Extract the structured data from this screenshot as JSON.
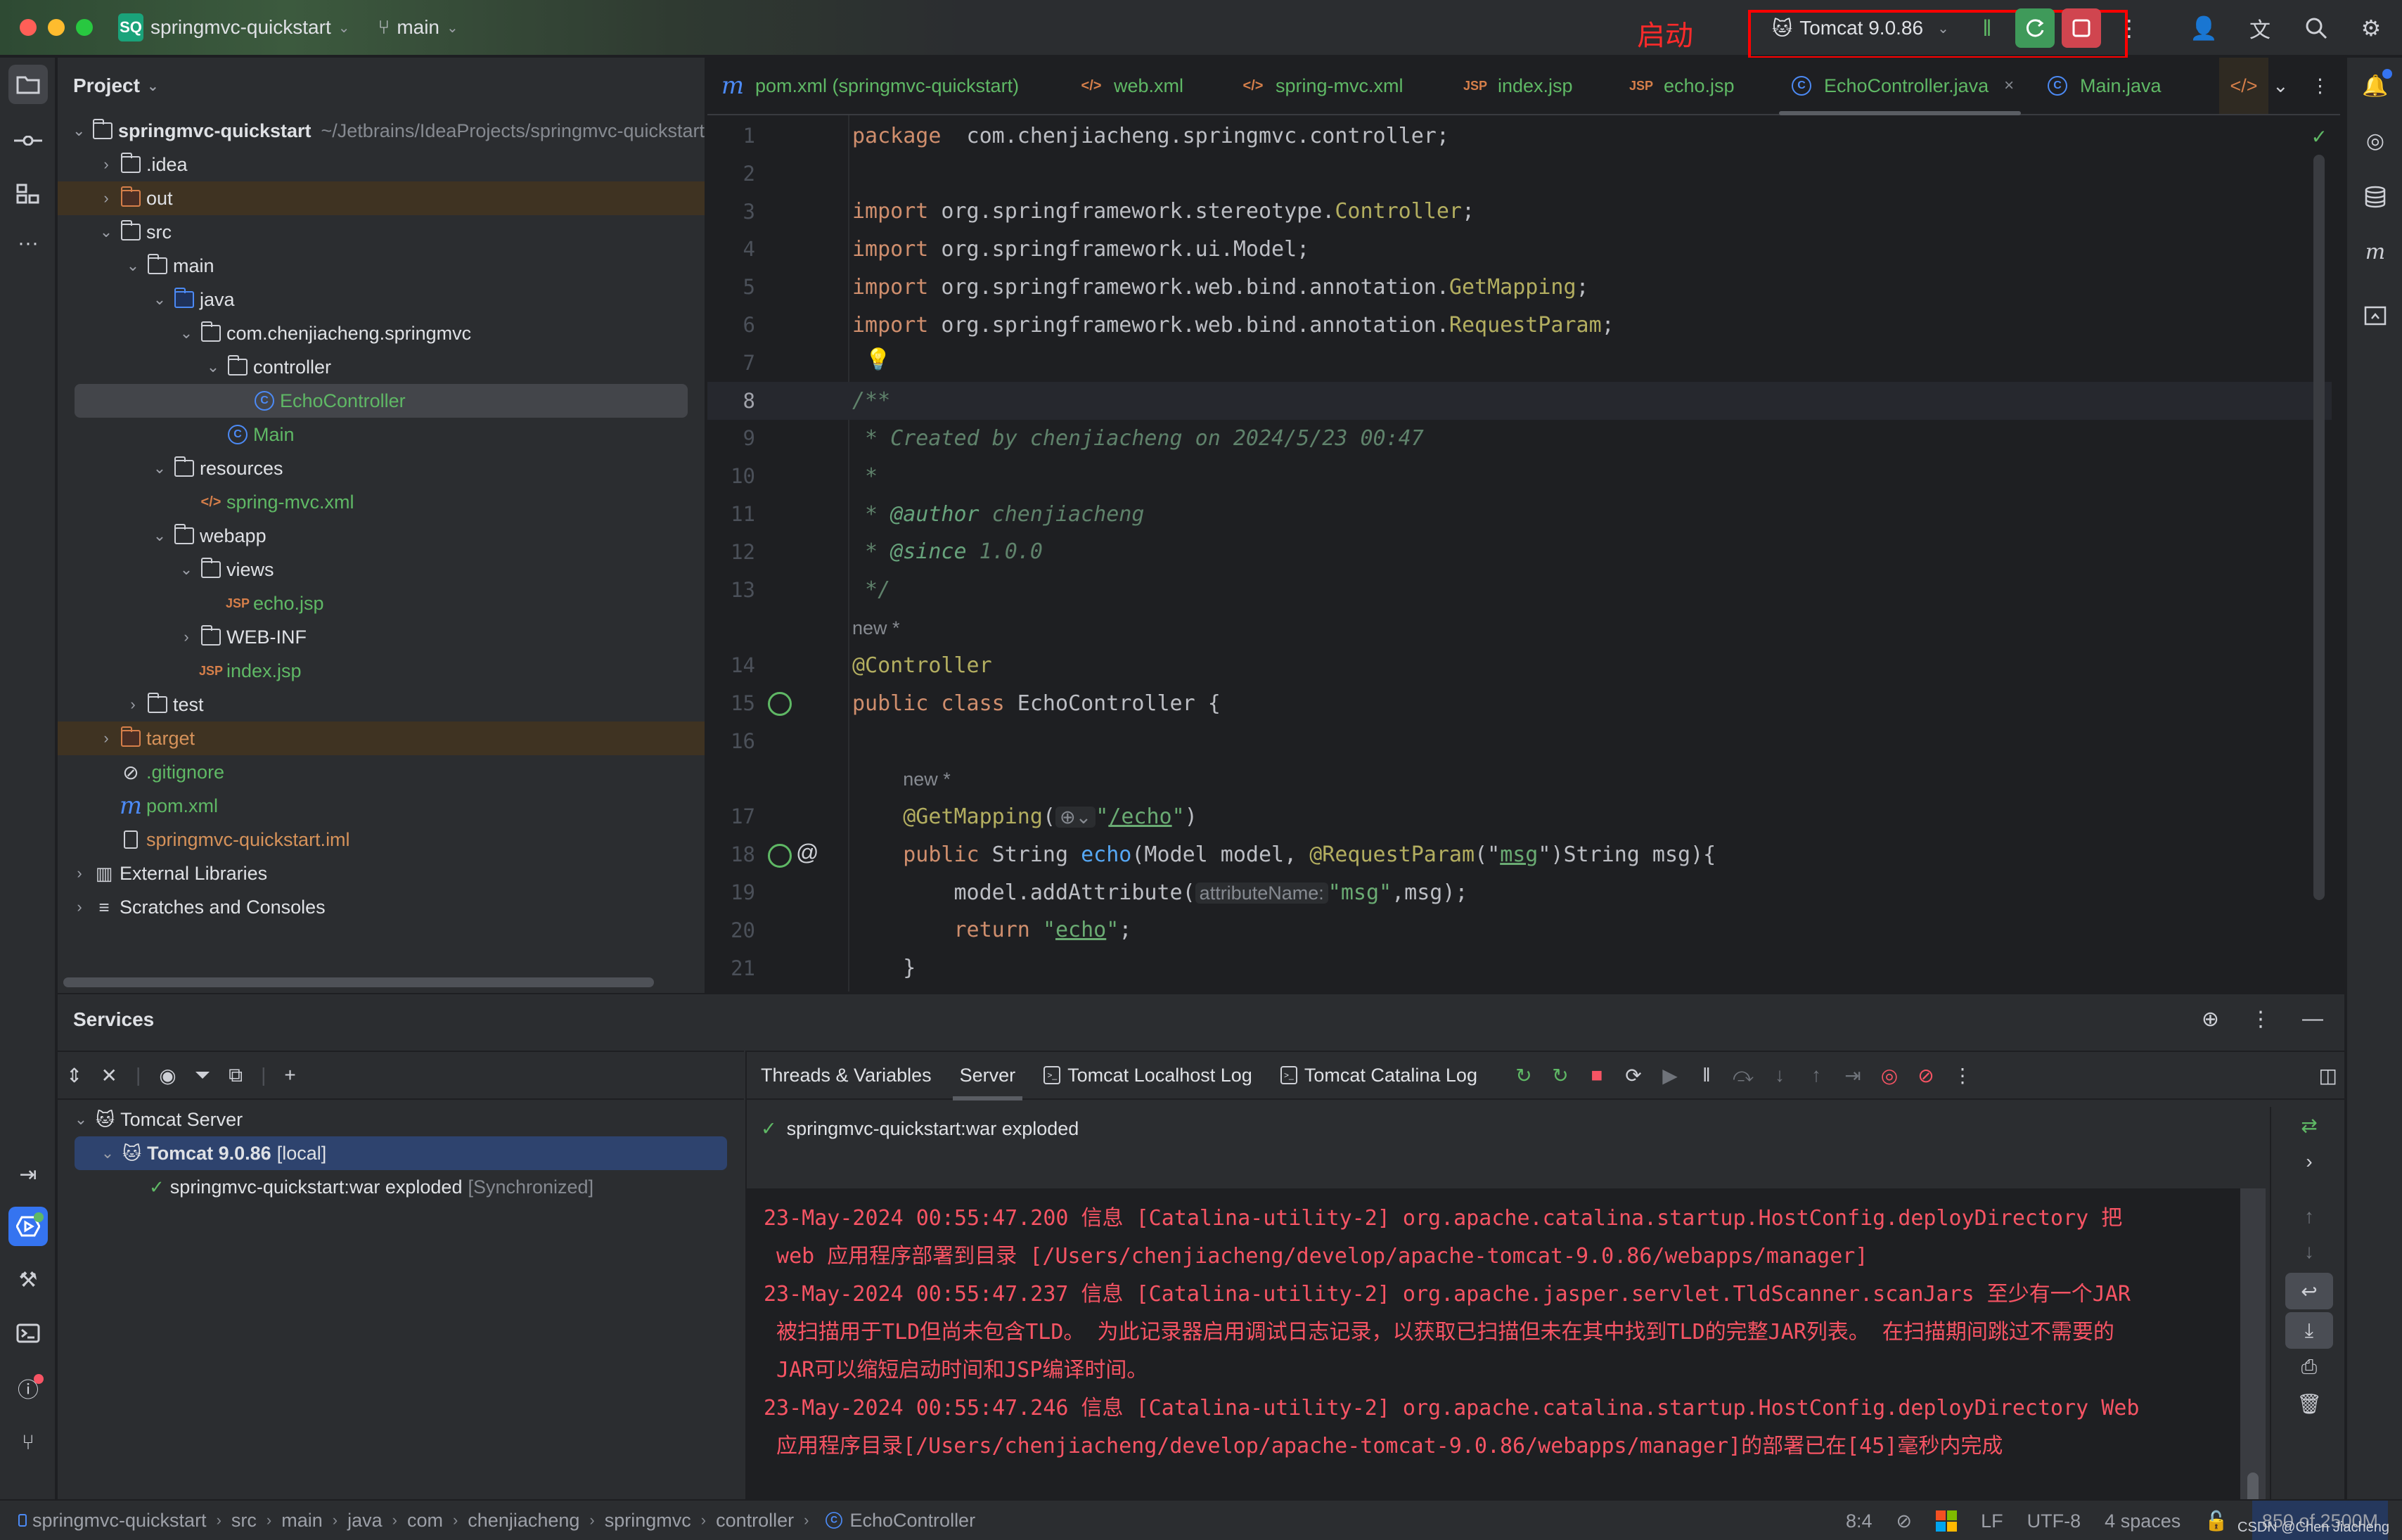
{
  "titlebar": {
    "project_badge": "SQ",
    "project_name": "springmvc-quickstart",
    "branch": "main",
    "annotation_label": "启动",
    "run_config": "Tomcat 9.0.86"
  },
  "left_strip": {
    "items": [
      "project",
      "commit",
      "structure",
      "more",
      "run-services",
      "services",
      "build",
      "terminal",
      "problems",
      "git"
    ]
  },
  "project_panel": {
    "title": "Project",
    "tree": [
      {
        "label": "springmvc-quickstart",
        "extra": "~/Jetbrains/IdeaProjects/springmvc-quickstart",
        "depth": 0,
        "arrow": "v",
        "icon": "module-folder",
        "style": "bold"
      },
      {
        "label": ".idea",
        "depth": 1,
        "arrow": ">",
        "icon": "folder"
      },
      {
        "label": "out",
        "depth": 1,
        "arrow": ">",
        "icon": "folder-orange",
        "style": "excluded"
      },
      {
        "label": "src",
        "depth": 1,
        "arrow": "v",
        "icon": "folder"
      },
      {
        "label": "main",
        "depth": 2,
        "arrow": "v",
        "icon": "folder"
      },
      {
        "label": "java",
        "depth": 3,
        "arrow": "v",
        "icon": "folder-blue"
      },
      {
        "label": "com.chenjiacheng.springmvc",
        "depth": 4,
        "arrow": "v",
        "icon": "package"
      },
      {
        "label": "controller",
        "depth": 5,
        "arrow": "v",
        "icon": "package"
      },
      {
        "label": "EchoController",
        "depth": 6,
        "arrow": "",
        "icon": "class",
        "style": "green selected"
      },
      {
        "label": "Main",
        "depth": 5,
        "arrow": "",
        "icon": "class",
        "style": "green"
      },
      {
        "label": "resources",
        "depth": 3,
        "arrow": "v",
        "icon": "resources"
      },
      {
        "label": "spring-mvc.xml",
        "depth": 4,
        "arrow": "",
        "icon": "xml",
        "style": "green"
      },
      {
        "label": "webapp",
        "depth": 3,
        "arrow": "v",
        "icon": "web-folder"
      },
      {
        "label": "views",
        "depth": 4,
        "arrow": "v",
        "icon": "folder"
      },
      {
        "label": "echo.jsp",
        "depth": 5,
        "arrow": "",
        "icon": "jsp",
        "style": "green"
      },
      {
        "label": "WEB-INF",
        "depth": 4,
        "arrow": ">",
        "icon": "folder"
      },
      {
        "label": "index.jsp",
        "depth": 4,
        "arrow": "",
        "icon": "jsp",
        "style": "green"
      },
      {
        "label": "test",
        "depth": 2,
        "arrow": ">",
        "icon": "folder"
      },
      {
        "label": "target",
        "depth": 1,
        "arrow": ">",
        "icon": "folder-orange",
        "style": "excluded orange"
      },
      {
        "label": ".gitignore",
        "depth": 1,
        "arrow": "",
        "icon": "ignore",
        "style": "green"
      },
      {
        "label": "pom.xml",
        "depth": 1,
        "arrow": "",
        "icon": "maven",
        "style": "green"
      },
      {
        "label": "springmvc-quickstart.iml",
        "depth": 1,
        "arrow": "",
        "icon": "iml",
        "style": "orange"
      },
      {
        "label": "External Libraries",
        "depth": 0,
        "arrow": ">",
        "icon": "libraries"
      },
      {
        "label": "Scratches and Consoles",
        "depth": 0,
        "arrow": ">",
        "icon": "scratches"
      }
    ]
  },
  "editor_tabs": [
    {
      "label": "pom.xml (springmvc-quickstart)",
      "icon": "maven"
    },
    {
      "label": "web.xml",
      "icon": "xml-web"
    },
    {
      "label": "spring-mvc.xml",
      "icon": "xml-spring"
    },
    {
      "label": "index.jsp",
      "icon": "jsp"
    },
    {
      "label": "echo.jsp",
      "icon": "jsp"
    },
    {
      "label": "EchoController.java",
      "icon": "class",
      "active": true
    },
    {
      "label": "Main.java",
      "icon": "class"
    }
  ],
  "editor": {
    "current_line": 8,
    "inlay_new": "new *",
    "hint_attribute_name": "attributeName:",
    "lines": [
      {
        "n": "1",
        "segs": [
          [
            "kw",
            "package"
          ],
          [
            "",
            "  com.chenjiacheng.springmvc.controller;"
          ]
        ]
      },
      {
        "n": "2",
        "segs": []
      },
      {
        "n": "3",
        "segs": [
          [
            "kw",
            "import"
          ],
          [
            "",
            " org.springframework.stereotype."
          ],
          [
            "ann",
            "Controller"
          ],
          [
            "",
            ";"
          ]
        ]
      },
      {
        "n": "4",
        "segs": [
          [
            "kw",
            "import"
          ],
          [
            "",
            " org.springframework.ui.Model;"
          ]
        ]
      },
      {
        "n": "5",
        "segs": [
          [
            "kw",
            "import"
          ],
          [
            "",
            " org.springframework.web.bind.annotation."
          ],
          [
            "ann",
            "GetMapping"
          ],
          [
            "",
            ";"
          ]
        ]
      },
      {
        "n": "6",
        "segs": [
          [
            "kw",
            "import"
          ],
          [
            "",
            " org.springframework.web.bind.annotation."
          ],
          [
            "ann",
            "RequestParam"
          ],
          [
            "",
            ";"
          ]
        ]
      },
      {
        "n": "7",
        "segs": []
      },
      {
        "n": "8",
        "segs": [
          [
            "cmt",
            "/**"
          ]
        ]
      },
      {
        "n": "9",
        "segs": [
          [
            "cmt",
            " * Created by chenjiacheng on 2024/5/23 00:47"
          ]
        ]
      },
      {
        "n": "10",
        "segs": [
          [
            "cmt",
            " *"
          ]
        ]
      },
      {
        "n": "11",
        "segs": [
          [
            "cmt",
            " * "
          ],
          [
            "cmt-tag",
            "@author"
          ],
          [
            "cmt",
            " chenjiacheng"
          ]
        ]
      },
      {
        "n": "12",
        "segs": [
          [
            "cmt",
            " * "
          ],
          [
            "cmt-tag",
            "@since"
          ],
          [
            "cmt",
            " 1.0.0"
          ]
        ]
      },
      {
        "n": "13",
        "segs": [
          [
            "cmt",
            " */"
          ]
        ]
      },
      {
        "n": "",
        "segs": [
          [
            "inlay",
            "new *"
          ]
        ]
      },
      {
        "n": "14",
        "segs": [
          [
            "ann",
            "@Controller"
          ]
        ]
      },
      {
        "n": "15",
        "segs": [
          [
            "kw",
            "public class"
          ],
          [
            "",
            " EchoController {"
          ]
        ]
      },
      {
        "n": "16",
        "segs": []
      },
      {
        "n": "",
        "segs": [
          [
            "",
            "    "
          ],
          [
            "inlay",
            "new *"
          ]
        ]
      },
      {
        "n": "17",
        "segs": [
          [
            "",
            "    "
          ],
          [
            "ann",
            "@GetMapping"
          ],
          [
            "",
            "("
          ],
          [
            "globe",
            "🌐⌄"
          ],
          [
            "str",
            "\""
          ],
          [
            "str ul",
            "/echo"
          ],
          [
            "str",
            "\""
          ],
          [
            "",
            ")"
          ]
        ]
      },
      {
        "n": "18",
        "segs": [
          [
            "",
            "    "
          ],
          [
            "kw",
            "public"
          ],
          [
            "",
            " String "
          ],
          [
            "fn",
            "echo"
          ],
          [
            "",
            "(Model model, "
          ],
          [
            "ann",
            "@RequestParam"
          ],
          [
            "",
            "(\""
          ],
          [
            "str ul",
            "msg"
          ],
          [
            "",
            "\")String msg){"
          ]
        ]
      },
      {
        "n": "19",
        "segs": [
          [
            "",
            "        model.addAttribute("
          ],
          [
            "hint",
            "attributeName:"
          ],
          [
            "str",
            "\"msg\""
          ],
          [
            "",
            ",msg);"
          ]
        ]
      },
      {
        "n": "20",
        "segs": [
          [
            "",
            "        "
          ],
          [
            "kw",
            "return"
          ],
          [
            "",
            " "
          ],
          [
            "str",
            "\""
          ],
          [
            "str ul",
            "echo"
          ],
          [
            "str",
            "\""
          ],
          [
            "",
            ";"
          ]
        ]
      },
      {
        "n": "21",
        "segs": [
          [
            "",
            "    }"
          ]
        ]
      }
    ]
  },
  "services": {
    "title": "Services",
    "tree": [
      {
        "label": "Tomcat Server",
        "depth": 0,
        "arrow": "v"
      },
      {
        "label": "Tomcat 9.0.86",
        "suffix": "[local]",
        "depth": 1,
        "arrow": "v",
        "selected": true
      },
      {
        "label": "springmvc-quickstart:war exploded",
        "suffix": "[Synchronized]",
        "depth": 2,
        "arrow": ""
      }
    ],
    "tabs": [
      {
        "label": "Threads & Variables"
      },
      {
        "label": "Server",
        "active": true
      },
      {
        "label": "Tomcat Localhost Log",
        "icon": "terminal"
      },
      {
        "label": "Tomcat Catalina Log",
        "icon": "terminal"
      }
    ],
    "deployment": "springmvc-quickstart:war exploded",
    "console_lines": [
      "23-May-2024 00:55:47.200 信息 [Catalina-utility-2] org.apache.catalina.startup.HostConfig.deployDirectory 把",
      " web 应用程序部署到目录 [/Users/chenjiacheng/develop/apache-tomcat-9.0.86/webapps/manager]",
      "23-May-2024 00:55:47.237 信息 [Catalina-utility-2] org.apache.jasper.servlet.TldScanner.scanJars 至少有一个JAR",
      " 被扫描用于TLD但尚未包含TLD。 为此记录器启用调试日志记录，以获取已扫描但未在其中找到TLD的完整JAR列表。 在扫描期间跳过不需要的",
      " JAR可以缩短启动时间和JSP编译时间。",
      "23-May-2024 00:55:47.246 信息 [Catalina-utility-2] org.apache.catalina.startup.HostConfig.deployDirectory Web",
      " 应用程序目录[/Users/chenjiacheng/develop/apache-tomcat-9.0.86/webapps/manager]的部署已在[45]毫秒内完成"
    ]
  },
  "statusbar": {
    "breadcrumb": [
      "springmvc-quickstart",
      "src",
      "main",
      "java",
      "com",
      "chenjiacheng",
      "springmvc",
      "controller",
      "EchoController"
    ],
    "caret": "8:4",
    "line_separator": "LF",
    "encoding": "UTF-8",
    "indent": "4 spaces",
    "memory": "850 of 2500M",
    "watermark": "CSDN @Chen Jiacheng"
  },
  "colors": {
    "accent_blue": "#3574f0",
    "run_green": "#3f9a5a",
    "stop_red": "#d0454f",
    "log_red": "#f75464",
    "annotation_red": "#ff0000"
  }
}
